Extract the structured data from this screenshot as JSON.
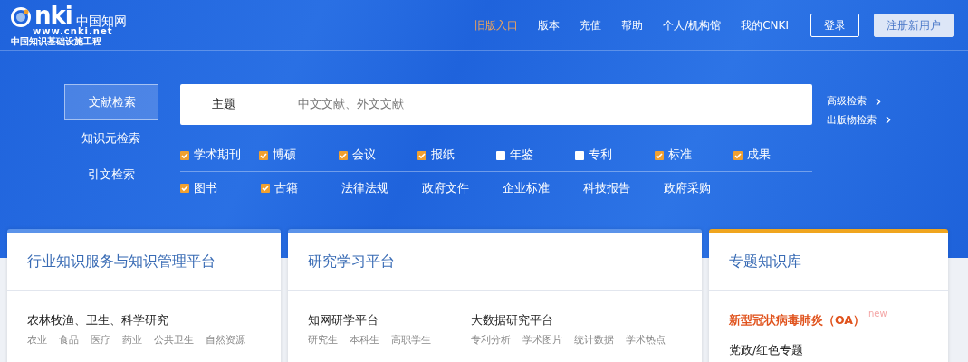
{
  "header": {
    "logo": {
      "wordmark": "nki",
      "name": "中国知网",
      "url": "www.cnki.net",
      "tagline": "中国知识基础设施工程"
    },
    "nav": [
      {
        "label": "旧版入口",
        "highlight": true
      },
      {
        "label": "版本",
        "highlight": false
      },
      {
        "label": "充值",
        "highlight": false
      },
      {
        "label": "帮助",
        "highlight": false
      },
      {
        "label": "个人/机构馆",
        "highlight": false
      },
      {
        "label": "我的CNKI",
        "highlight": false
      }
    ],
    "buttons": [
      {
        "label": "登录",
        "kind": "outline"
      },
      {
        "label": "注册新用户",
        "kind": "filled"
      }
    ]
  },
  "search_tabs": [
    {
      "label": "文献检索",
      "selected": true
    },
    {
      "label": "知识元检索",
      "selected": false
    },
    {
      "label": "引文检索",
      "selected": false
    }
  ],
  "search": {
    "field_label": "主题",
    "placeholder": "中文文献、外文文献"
  },
  "side_links": [
    "高级检索",
    "出版物检索"
  ],
  "databases": [
    [
      {
        "label": "学术期刊",
        "kind": "checkbox",
        "checked": true
      },
      {
        "label": "博硕",
        "kind": "checkbox",
        "checked": true
      },
      {
        "label": "会议",
        "kind": "checkbox",
        "checked": true
      },
      {
        "label": "报纸",
        "kind": "checkbox",
        "checked": true
      },
      {
        "label": "年鉴",
        "kind": "checkbox",
        "checked": false
      },
      {
        "label": "专利",
        "kind": "checkbox",
        "checked": false
      },
      {
        "label": "标准",
        "kind": "checkbox",
        "checked": true
      },
      {
        "label": "成果",
        "kind": "checkbox",
        "checked": true
      }
    ],
    [
      {
        "label": "图书",
        "kind": "checkbox",
        "checked": true
      },
      {
        "label": "古籍",
        "kind": "checkbox",
        "checked": true
      },
      {
        "label": "法律法规",
        "kind": "plain"
      },
      {
        "label": "政府文件",
        "kind": "plain"
      },
      {
        "label": "企业标准",
        "kind": "plain"
      },
      {
        "label": "科技报告",
        "kind": "plain"
      },
      {
        "label": "政府采购",
        "kind": "plain"
      }
    ]
  ],
  "cards": [
    {
      "title": "行业知识服务与知识管理平台",
      "highlight": false,
      "columns": [
        [
          {
            "heading": "农林牧渔、卫生、科学研究",
            "kind": "plain",
            "items": [
              "农业",
              "食品",
              "医疗",
              "药业",
              "公共卫生",
              "自然资源"
            ]
          }
        ]
      ]
    },
    {
      "title": "研究学习平台",
      "highlight": false,
      "columns": [
        [
          {
            "heading": "知网研学平台",
            "kind": "plain",
            "items": [
              "研究生",
              "本科生",
              "高职学生"
            ]
          }
        ],
        [
          {
            "heading": "大数据研究平台",
            "kind": "plain",
            "items": [
              "专利分析",
              "学术图片",
              "统计数据",
              "学术热点"
            ]
          }
        ]
      ]
    },
    {
      "title": "专题知识库",
      "highlight": true,
      "columns": [
        [
          {
            "heading": "新型冠状病毒肺炎（OA）",
            "kind": "featured",
            "badge": "new"
          },
          {
            "heading": "党政/红色专题",
            "kind": "plain"
          }
        ]
      ]
    }
  ]
}
